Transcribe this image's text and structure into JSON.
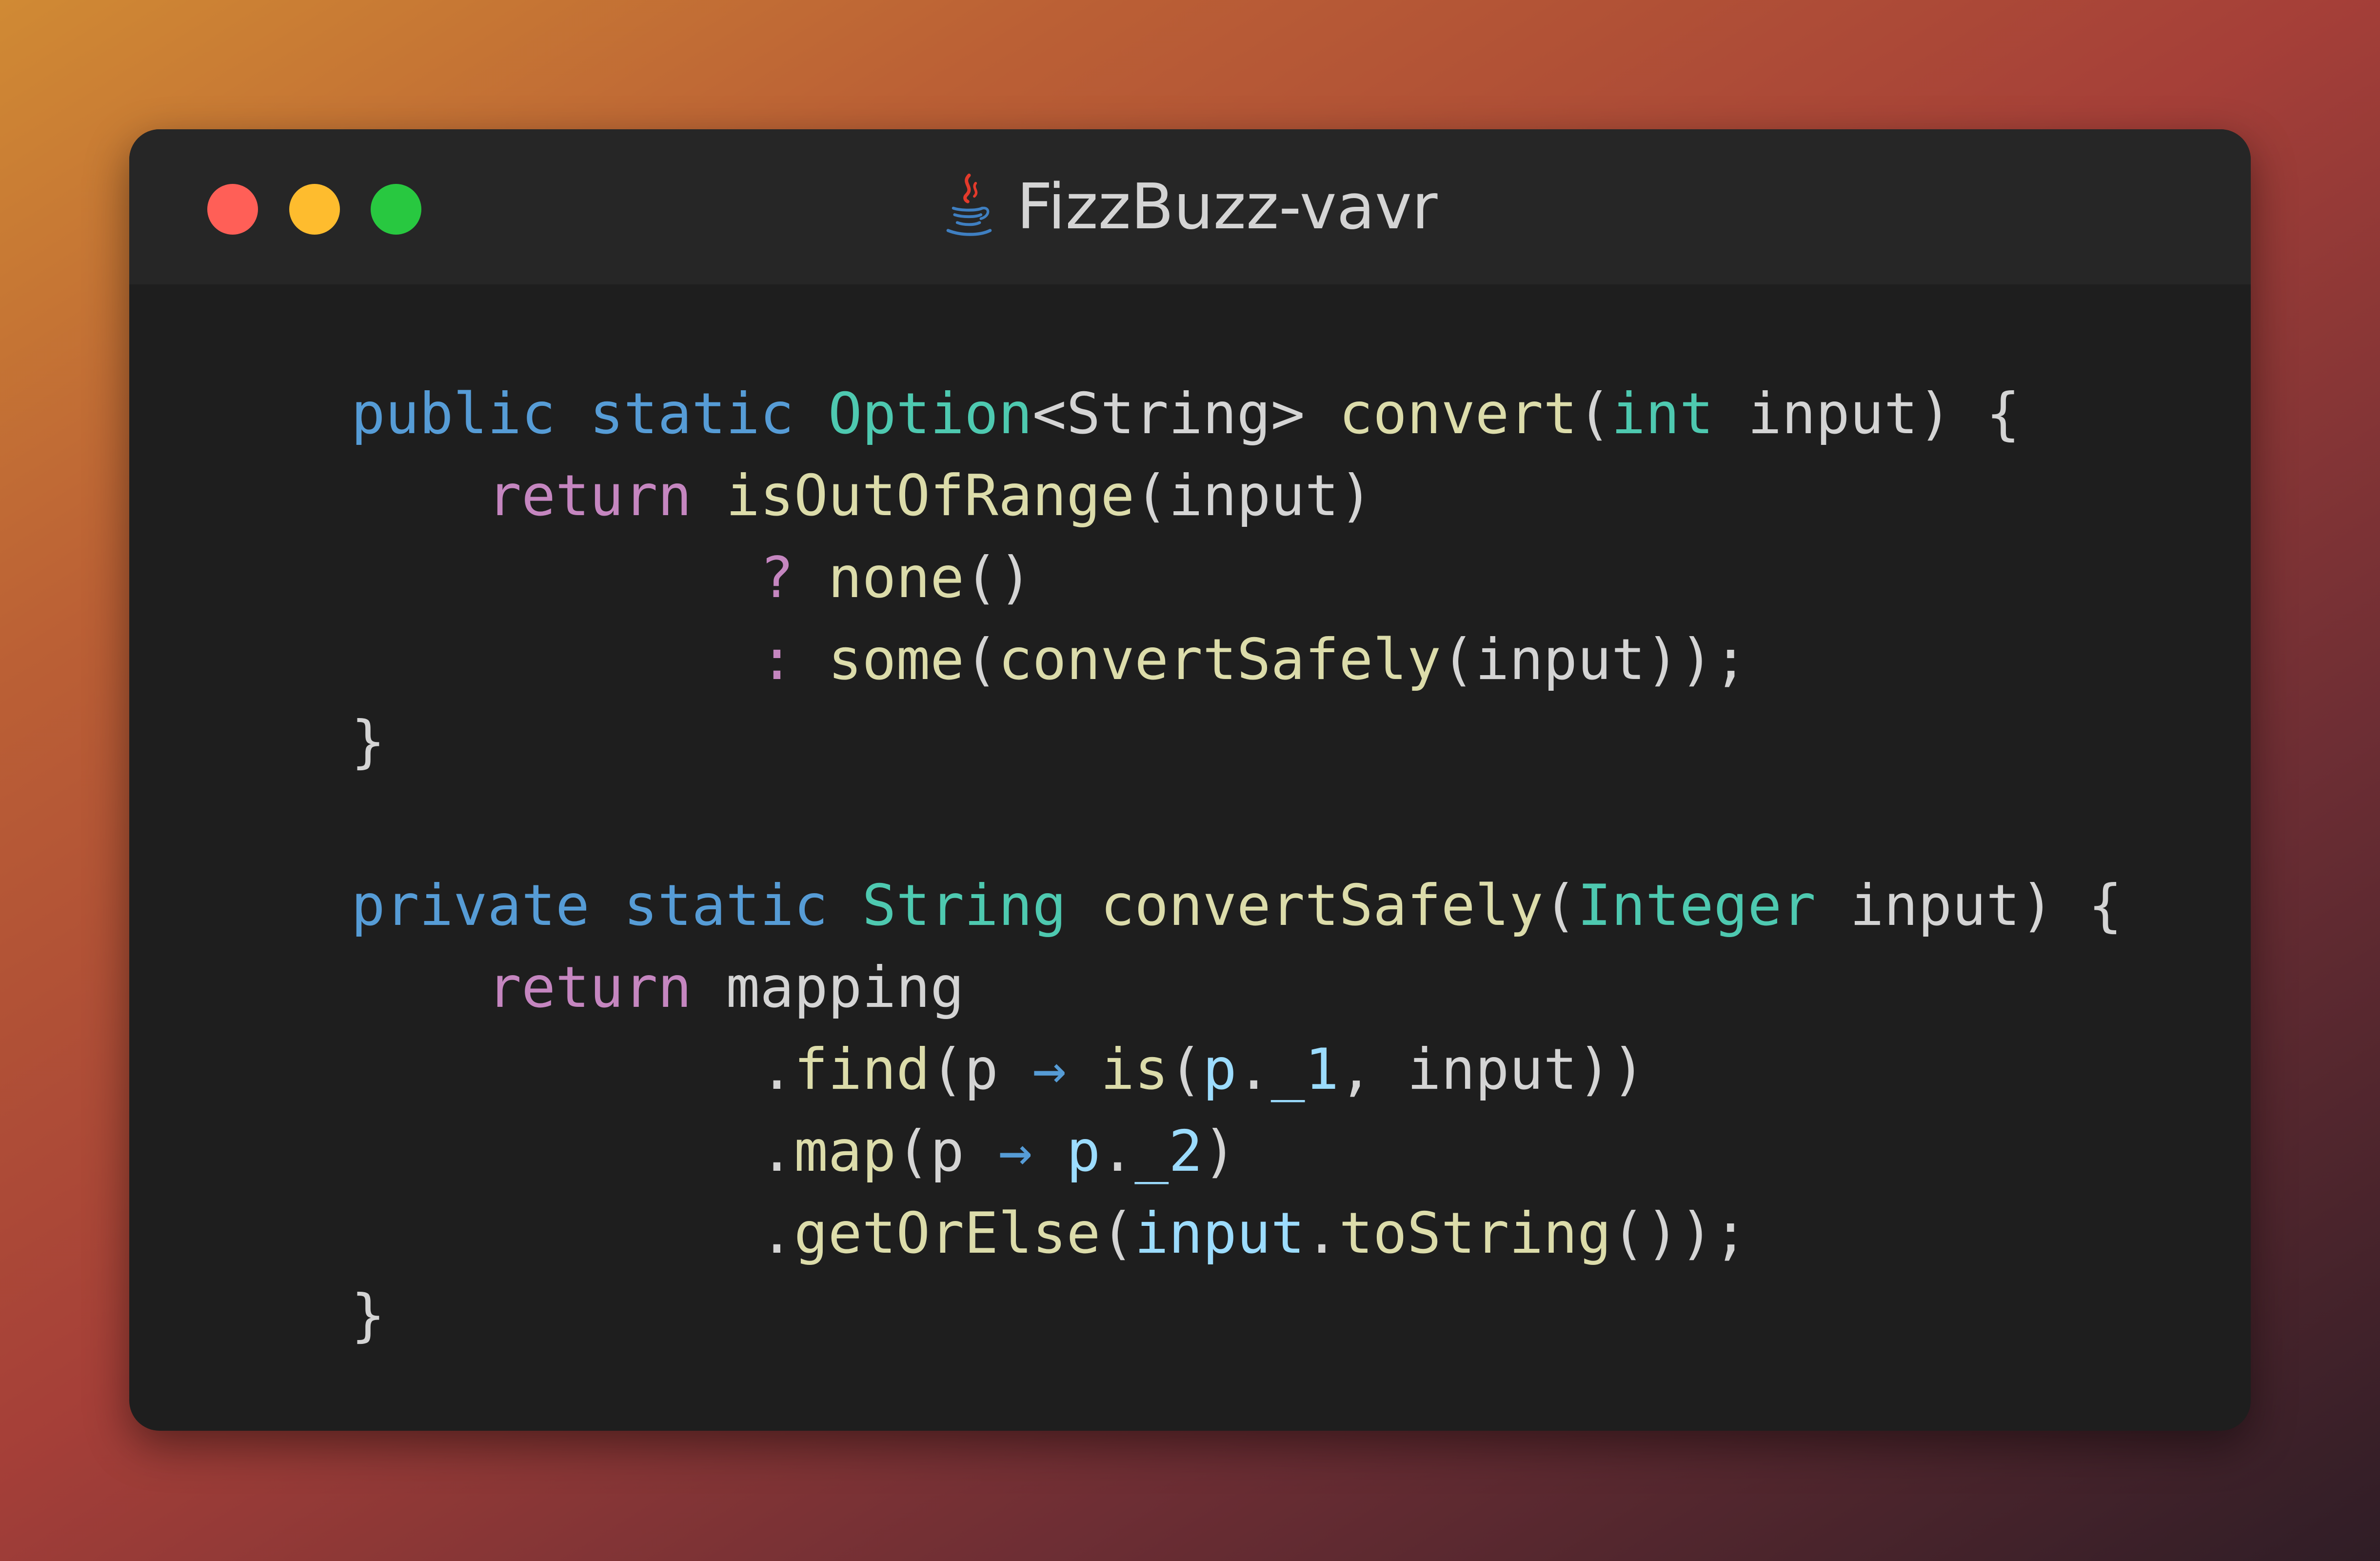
{
  "window": {
    "title": "FizzBuzz-vavr",
    "title_icon": "java-coffee-cup-icon",
    "traffic_lights": {
      "close_color": "#ff5f57",
      "minimize_color": "#febc2e",
      "maximize_color": "#28c840"
    }
  },
  "colors": {
    "keyword": "#569cd6",
    "control": "#c586c0",
    "type": "#4ec9b0",
    "function": "#dcdcaa",
    "variable": "#9cdcfe",
    "text": "#d4d4d4",
    "editor_background": "#1e1e1e",
    "titlebar_background": "#262626"
  },
  "code": {
    "language": "java",
    "lines": [
      [
        {
          "t": "public",
          "k": "keyword"
        },
        {
          "t": " ",
          "k": "text"
        },
        {
          "t": "static",
          "k": "keyword"
        },
        {
          "t": " ",
          "k": "text"
        },
        {
          "t": "Option",
          "k": "type"
        },
        {
          "t": "<String> ",
          "k": "text"
        },
        {
          "t": "convert",
          "k": "func"
        },
        {
          "t": "(",
          "k": "text"
        },
        {
          "t": "int",
          "k": "type"
        },
        {
          "t": " input) {",
          "k": "text"
        }
      ],
      [
        {
          "t": "    ",
          "k": "text"
        },
        {
          "t": "return",
          "k": "control"
        },
        {
          "t": " ",
          "k": "text"
        },
        {
          "t": "isOutOfRange",
          "k": "func"
        },
        {
          "t": "(input)",
          "k": "text"
        }
      ],
      [
        {
          "t": "            ",
          "k": "text"
        },
        {
          "t": "?",
          "k": "control"
        },
        {
          "t": " ",
          "k": "text"
        },
        {
          "t": "none",
          "k": "func"
        },
        {
          "t": "()",
          "k": "text"
        }
      ],
      [
        {
          "t": "            ",
          "k": "text"
        },
        {
          "t": ":",
          "k": "control"
        },
        {
          "t": " ",
          "k": "text"
        },
        {
          "t": "some",
          "k": "func"
        },
        {
          "t": "(",
          "k": "text"
        },
        {
          "t": "convertSafely",
          "k": "func"
        },
        {
          "t": "(input));",
          "k": "text"
        }
      ],
      [
        {
          "t": "}",
          "k": "text"
        }
      ],
      [],
      [
        {
          "t": "private",
          "k": "keyword"
        },
        {
          "t": " ",
          "k": "text"
        },
        {
          "t": "static",
          "k": "keyword"
        },
        {
          "t": " ",
          "k": "text"
        },
        {
          "t": "String",
          "k": "type"
        },
        {
          "t": " ",
          "k": "text"
        },
        {
          "t": "convertSafely",
          "k": "func"
        },
        {
          "t": "(",
          "k": "text"
        },
        {
          "t": "Integer",
          "k": "type"
        },
        {
          "t": " input) {",
          "k": "text"
        }
      ],
      [
        {
          "t": "    ",
          "k": "text"
        },
        {
          "t": "return",
          "k": "control"
        },
        {
          "t": " mapping",
          "k": "text"
        }
      ],
      [
        {
          "t": "            .",
          "k": "text"
        },
        {
          "t": "find",
          "k": "func"
        },
        {
          "t": "(p ",
          "k": "text"
        },
        {
          "t": "→",
          "k": "op"
        },
        {
          "t": " ",
          "k": "text"
        },
        {
          "t": "is",
          "k": "func"
        },
        {
          "t": "(",
          "k": "text"
        },
        {
          "t": "p",
          "k": "var"
        },
        {
          "t": ".",
          "k": "text"
        },
        {
          "t": "_1",
          "k": "var"
        },
        {
          "t": ", input))",
          "k": "text"
        }
      ],
      [
        {
          "t": "            .",
          "k": "text"
        },
        {
          "t": "map",
          "k": "func"
        },
        {
          "t": "(p ",
          "k": "text"
        },
        {
          "t": "→",
          "k": "op"
        },
        {
          "t": " ",
          "k": "text"
        },
        {
          "t": "p",
          "k": "var"
        },
        {
          "t": ".",
          "k": "text"
        },
        {
          "t": "_2",
          "k": "var"
        },
        {
          "t": ")",
          "k": "text"
        }
      ],
      [
        {
          "t": "            .",
          "k": "text"
        },
        {
          "t": "getOrElse",
          "k": "func"
        },
        {
          "t": "(",
          "k": "text"
        },
        {
          "t": "input",
          "k": "var"
        },
        {
          "t": ".",
          "k": "text"
        },
        {
          "t": "toString",
          "k": "func"
        },
        {
          "t": "());",
          "k": "text"
        }
      ],
      [
        {
          "t": "}",
          "k": "text"
        }
      ]
    ]
  }
}
